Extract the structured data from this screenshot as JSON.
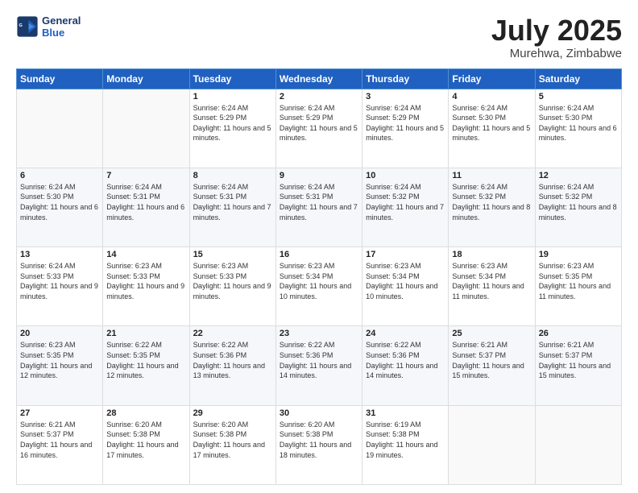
{
  "logo": {
    "text_general": "General",
    "text_blue": "Blue"
  },
  "title": "July 2025",
  "location": "Murehwa, Zimbabwe",
  "days_of_week": [
    "Sunday",
    "Monday",
    "Tuesday",
    "Wednesday",
    "Thursday",
    "Friday",
    "Saturday"
  ],
  "weeks": [
    [
      {
        "day": "",
        "info": ""
      },
      {
        "day": "",
        "info": ""
      },
      {
        "day": "1",
        "info": "Sunrise: 6:24 AM\nSunset: 5:29 PM\nDaylight: 11 hours and 5 minutes."
      },
      {
        "day": "2",
        "info": "Sunrise: 6:24 AM\nSunset: 5:29 PM\nDaylight: 11 hours and 5 minutes."
      },
      {
        "day": "3",
        "info": "Sunrise: 6:24 AM\nSunset: 5:29 PM\nDaylight: 11 hours and 5 minutes."
      },
      {
        "day": "4",
        "info": "Sunrise: 6:24 AM\nSunset: 5:30 PM\nDaylight: 11 hours and 5 minutes."
      },
      {
        "day": "5",
        "info": "Sunrise: 6:24 AM\nSunset: 5:30 PM\nDaylight: 11 hours and 6 minutes."
      }
    ],
    [
      {
        "day": "6",
        "info": "Sunrise: 6:24 AM\nSunset: 5:30 PM\nDaylight: 11 hours and 6 minutes."
      },
      {
        "day": "7",
        "info": "Sunrise: 6:24 AM\nSunset: 5:31 PM\nDaylight: 11 hours and 6 minutes."
      },
      {
        "day": "8",
        "info": "Sunrise: 6:24 AM\nSunset: 5:31 PM\nDaylight: 11 hours and 7 minutes."
      },
      {
        "day": "9",
        "info": "Sunrise: 6:24 AM\nSunset: 5:31 PM\nDaylight: 11 hours and 7 minutes."
      },
      {
        "day": "10",
        "info": "Sunrise: 6:24 AM\nSunset: 5:32 PM\nDaylight: 11 hours and 7 minutes."
      },
      {
        "day": "11",
        "info": "Sunrise: 6:24 AM\nSunset: 5:32 PM\nDaylight: 11 hours and 8 minutes."
      },
      {
        "day": "12",
        "info": "Sunrise: 6:24 AM\nSunset: 5:32 PM\nDaylight: 11 hours and 8 minutes."
      }
    ],
    [
      {
        "day": "13",
        "info": "Sunrise: 6:24 AM\nSunset: 5:33 PM\nDaylight: 11 hours and 9 minutes."
      },
      {
        "day": "14",
        "info": "Sunrise: 6:23 AM\nSunset: 5:33 PM\nDaylight: 11 hours and 9 minutes."
      },
      {
        "day": "15",
        "info": "Sunrise: 6:23 AM\nSunset: 5:33 PM\nDaylight: 11 hours and 9 minutes."
      },
      {
        "day": "16",
        "info": "Sunrise: 6:23 AM\nSunset: 5:34 PM\nDaylight: 11 hours and 10 minutes."
      },
      {
        "day": "17",
        "info": "Sunrise: 6:23 AM\nSunset: 5:34 PM\nDaylight: 11 hours and 10 minutes."
      },
      {
        "day": "18",
        "info": "Sunrise: 6:23 AM\nSunset: 5:34 PM\nDaylight: 11 hours and 11 minutes."
      },
      {
        "day": "19",
        "info": "Sunrise: 6:23 AM\nSunset: 5:35 PM\nDaylight: 11 hours and 11 minutes."
      }
    ],
    [
      {
        "day": "20",
        "info": "Sunrise: 6:23 AM\nSunset: 5:35 PM\nDaylight: 11 hours and 12 minutes."
      },
      {
        "day": "21",
        "info": "Sunrise: 6:22 AM\nSunset: 5:35 PM\nDaylight: 11 hours and 12 minutes."
      },
      {
        "day": "22",
        "info": "Sunrise: 6:22 AM\nSunset: 5:36 PM\nDaylight: 11 hours and 13 minutes."
      },
      {
        "day": "23",
        "info": "Sunrise: 6:22 AM\nSunset: 5:36 PM\nDaylight: 11 hours and 14 minutes."
      },
      {
        "day": "24",
        "info": "Sunrise: 6:22 AM\nSunset: 5:36 PM\nDaylight: 11 hours and 14 minutes."
      },
      {
        "day": "25",
        "info": "Sunrise: 6:21 AM\nSunset: 5:37 PM\nDaylight: 11 hours and 15 minutes."
      },
      {
        "day": "26",
        "info": "Sunrise: 6:21 AM\nSunset: 5:37 PM\nDaylight: 11 hours and 15 minutes."
      }
    ],
    [
      {
        "day": "27",
        "info": "Sunrise: 6:21 AM\nSunset: 5:37 PM\nDaylight: 11 hours and 16 minutes."
      },
      {
        "day": "28",
        "info": "Sunrise: 6:20 AM\nSunset: 5:38 PM\nDaylight: 11 hours and 17 minutes."
      },
      {
        "day": "29",
        "info": "Sunrise: 6:20 AM\nSunset: 5:38 PM\nDaylight: 11 hours and 17 minutes."
      },
      {
        "day": "30",
        "info": "Sunrise: 6:20 AM\nSunset: 5:38 PM\nDaylight: 11 hours and 18 minutes."
      },
      {
        "day": "31",
        "info": "Sunrise: 6:19 AM\nSunset: 5:38 PM\nDaylight: 11 hours and 19 minutes."
      },
      {
        "day": "",
        "info": ""
      },
      {
        "day": "",
        "info": ""
      }
    ]
  ]
}
